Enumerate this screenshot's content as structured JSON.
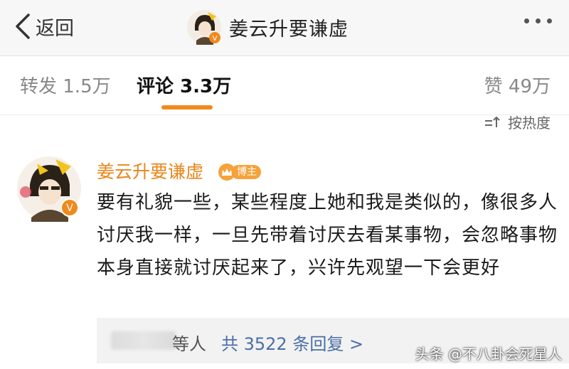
{
  "nav": {
    "back_label": "返回",
    "title": "姜云升要谦虚"
  },
  "tabs": {
    "repost": "转发 1.5万",
    "comment": "评论 3.3万",
    "like": "赞 49万",
    "active": "comment"
  },
  "sort": {
    "label": "按热度"
  },
  "comment": {
    "author": "姜云升要谦虚",
    "badge": "博主",
    "text": "要有礼貌一些，某些程度上她和我是类似的，像很多人讨厌我一样，一旦先带着讨厌去看某事物，会忽略事物本身直接就讨厌起来了，兴许先观望一下会更好",
    "replies_suffix": "等人",
    "replies_link": "共 3522 条回复 >"
  },
  "watermark": "头条 @不八卦会死星人",
  "colors": {
    "accent": "#f08a1c",
    "author_name": "#e8861a",
    "link": "#4a6fa5",
    "navbar_bg": "#f7f7f7"
  },
  "icons": {
    "back": "chevron-left-icon",
    "more": "more-dots-icon",
    "sort": "sort-icon",
    "verified": "verified-v-icon"
  }
}
